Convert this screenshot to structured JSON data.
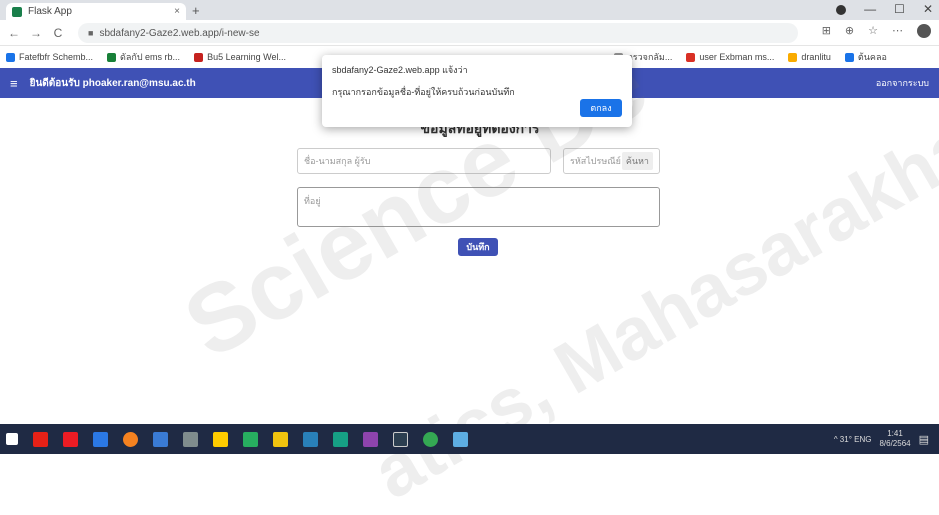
{
  "browser": {
    "tab_title": "Flask App",
    "tab_close": "×",
    "new_tab": "+",
    "win_min": "—",
    "win_max": "☐",
    "win_close": "✕",
    "back": "←",
    "forward": "→",
    "reload": "C",
    "url": "sbdafany2-Gaze2.web.app/i-new-se",
    "bookmarks": [
      {
        "label": "Fatefbfr Schemb...",
        "color": "#1a73e8"
      },
      {
        "label": "ดัลกัป ems rb...",
        "color": "#188038"
      },
      {
        "label": "Bu5 Learning Wel...",
        "color": "#c5221f"
      },
      {
        "label": "ตรวจกลัม...",
        "color": "#999999"
      },
      {
        "label": "user Exbman ms...",
        "color": "#d93025"
      },
      {
        "label": "dranlitu",
        "color": "#f9ab00"
      },
      {
        "label": "ต้นคลอ",
        "color": "#1a73e8"
      }
    ]
  },
  "appbar": {
    "menu_glyph": "≡",
    "title": "ยินดีต้อนรับ phoaker.ran@msu.ac.th",
    "logout": "ออกจากระบบ",
    "color": "#3f51b5"
  },
  "form": {
    "title": "ข้อมูลที่อยู่ที่ต้องการ",
    "name_placeholder": "ชื่อ-นามสกุล ผู้รับ",
    "code_placeholder": "รหัสไปรษณีย์",
    "code_suffix": "ค้นหา",
    "address_placeholder": "ที่อยู่",
    "save_label": "บันทึก"
  },
  "dialog": {
    "origin": "sbdafany2-Gaze2.web.app แจ้งว่า",
    "message": "กรุณากรอกข้อมูลชื่อ-ที่อยู่ให้ครบถ้วนก่อนบันทึก",
    "ok_label": "ตกลง"
  },
  "watermark": {
    "line1": "Science De",
    "line2": "atics, Mahasarakham"
  },
  "taskbar": {
    "icons": [
      {
        "name": "start",
        "color": "#ffffff"
      },
      {
        "name": "youtube",
        "color": "#e62117"
      },
      {
        "name": "adobe",
        "color": "#ec1c24"
      },
      {
        "name": "app-a",
        "color": "#2b78e4"
      },
      {
        "name": "app-b",
        "color": "#f58220"
      },
      {
        "name": "app-c",
        "color": "#3a7bd5"
      },
      {
        "name": "app-d",
        "color": "#7f8c8d"
      },
      {
        "name": "app-e",
        "color": "#ffcc00"
      },
      {
        "name": "app-f",
        "color": "#27ae60"
      },
      {
        "name": "app-g",
        "color": "#f1c40f"
      },
      {
        "name": "app-h",
        "color": "#2980b9"
      },
      {
        "name": "app-i",
        "color": "#16a085"
      },
      {
        "name": "app-j",
        "color": "#8e44ad"
      },
      {
        "name": "app-k",
        "color": "#2c3e50"
      },
      {
        "name": "chrome",
        "color": "#34a853"
      },
      {
        "name": "app-l",
        "color": "#5dade2"
      }
    ],
    "tray_text": "^ 31° ENG",
    "time": "1:41",
    "date": "8/6/2564"
  }
}
